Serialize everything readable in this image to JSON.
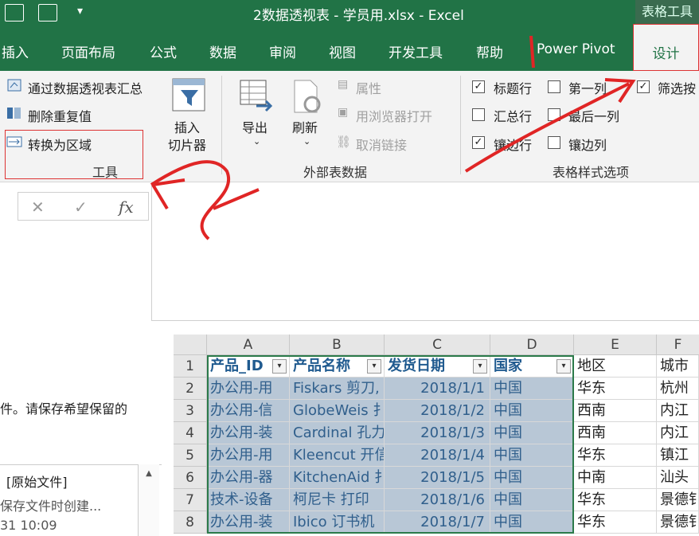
{
  "window": {
    "title": "2数据透视表 - 学员用.xlsx  -  Excel",
    "context_tab": "表格工具"
  },
  "tabs": [
    "插入",
    "页面布局",
    "公式",
    "数据",
    "审阅",
    "视图",
    "开发工具",
    "帮助",
    "Power Pivot",
    "设计"
  ],
  "ribbon": {
    "tools": {
      "summarize": "通过数据透视表汇总",
      "remove_dup": "删除重复值",
      "convert": "转换为区域",
      "group_label": "工具"
    },
    "slicer": {
      "line1": "插入",
      "line2": "切片器"
    },
    "external": {
      "export": "导出",
      "refresh": "刷新",
      "properties": "属性",
      "open_browser": "用浏览器打开",
      "unlink": "取消链接",
      "group_label": "外部表数据"
    },
    "style_options": {
      "header_row": "标题行",
      "total_row": "汇总行",
      "banded_rows": "镶边行",
      "first_col": "第一列",
      "last_col": "最后一列",
      "banded_cols": "镶边列",
      "filter_btn": "筛选按",
      "group_label": "表格样式选项"
    }
  },
  "formula_bar": {
    "cancel": "✕",
    "enter": "✓",
    "fx": "fx"
  },
  "left_panel": {
    "message": "件。请保存希望保留的",
    "file_label": "[原始文件]",
    "file_desc": "保存文件时创建...",
    "file_time": "31 10:09"
  },
  "grid": {
    "columns": [
      "A",
      "B",
      "C",
      "D",
      "E",
      "F"
    ],
    "rows": [
      "1",
      "2",
      "3",
      "4",
      "5",
      "6",
      "7",
      "8"
    ],
    "header": [
      "产品_ID",
      "产品名称",
      "发货日期",
      "国家",
      "地区",
      "城市"
    ],
    "data": [
      [
        "办公用-用",
        "Fiskars 剪刀,",
        "2018/1/1",
        "中国",
        "华东",
        "杭州"
      ],
      [
        "办公用-信",
        "GlobeWeis 扌",
        "2018/1/2",
        "中国",
        "西南",
        "内江"
      ],
      [
        "办公用-装",
        "Cardinal 孔力",
        "2018/1/3",
        "中国",
        "西南",
        "内江"
      ],
      [
        "办公用-用",
        "Kleencut 开信",
        "2018/1/4",
        "中国",
        "华东",
        "镇江"
      ],
      [
        "办公用-器",
        "KitchenAid 扌",
        "2018/1/5",
        "中国",
        "中南",
        "汕头"
      ],
      [
        "技术-设备",
        "柯尼卡 打印",
        "2018/1/6",
        "中国",
        "华东",
        "景德钅"
      ],
      [
        "办公用-装",
        "Ibico 订书机",
        "2018/1/7",
        "中国",
        "华东",
        "景德钅"
      ]
    ]
  }
}
